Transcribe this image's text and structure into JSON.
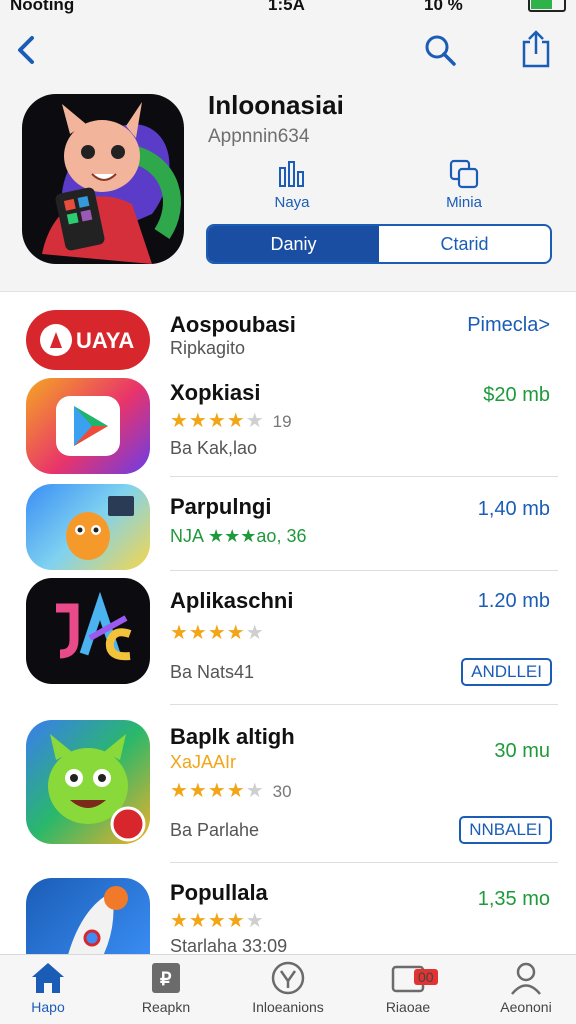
{
  "status_bar": {
    "carrier": "Nooting",
    "time": "1:5A",
    "battery_percent": "10 %",
    "battery_level": 0.7
  },
  "nav": {
    "back_icon": "chevron-left-icon",
    "search_icon": "search-icon",
    "share_icon": "share-icon"
  },
  "hero": {
    "title": "Inloonasiai",
    "subtitle": "Appnnin634",
    "meta": [
      {
        "icon": "chart-icon",
        "label": "Naya"
      },
      {
        "icon": "copy-icon",
        "label": "Minia"
      }
    ],
    "segments": [
      "Daniy",
      "Ctarid"
    ],
    "active_segment": 0
  },
  "apps": [
    {
      "name": "Aospoubasi",
      "line1": "Ripkagito",
      "stars": null,
      "rating_count": "",
      "line2": "",
      "price": "Pimecla>",
      "price_color": "blue",
      "button": ""
    },
    {
      "name": "Xopkiasi",
      "line1": "",
      "stars": 4,
      "rating_count": "19",
      "line2": "Ba Kak,lao",
      "price": "$20 mb",
      "price_color": "green",
      "button": ""
    },
    {
      "name": "Parpulngi",
      "line1": "NJA ★★​★ao, 36",
      "stars": null,
      "rating_count": "",
      "line2": "",
      "price": "1,40 mb",
      "price_color": "blue",
      "button": ""
    },
    {
      "name": "Aplikaschni",
      "line1": "",
      "stars": 4,
      "rating_count": "",
      "line2": "Ba Nats41",
      "price": "1.20 mb",
      "price_color": "blue",
      "button": "ANDLLEI"
    },
    {
      "name": "Baplk altigh",
      "line1": "XaJAAIr",
      "stars": 4,
      "rating_count": "30",
      "line2": "Ba Parlahe",
      "price": "30 mu",
      "price_color": "green",
      "button": "NNBALEI"
    },
    {
      "name": "Popullala",
      "line1": "",
      "stars": 4,
      "rating_count": "",
      "line2": "Starlaha 33:09",
      "price": "1,35 mo",
      "price_color": "green",
      "button": ""
    }
  ],
  "tabs": [
    {
      "label": "Hapo",
      "icon": "home-icon",
      "active": true
    },
    {
      "label": "Reapkn",
      "icon": "bookmark-icon",
      "active": false
    },
    {
      "label": "Inloeanions",
      "icon": "compass-icon",
      "active": false
    },
    {
      "label": "Riaoae",
      "icon": "updates-icon",
      "active": false,
      "badge": "00"
    },
    {
      "label": "Aeononi",
      "icon": "profile-icon",
      "active": false
    }
  ],
  "colors": {
    "accent": "#1b5db6",
    "price_green": "#1f9a3b",
    "star": "#f2a516"
  }
}
